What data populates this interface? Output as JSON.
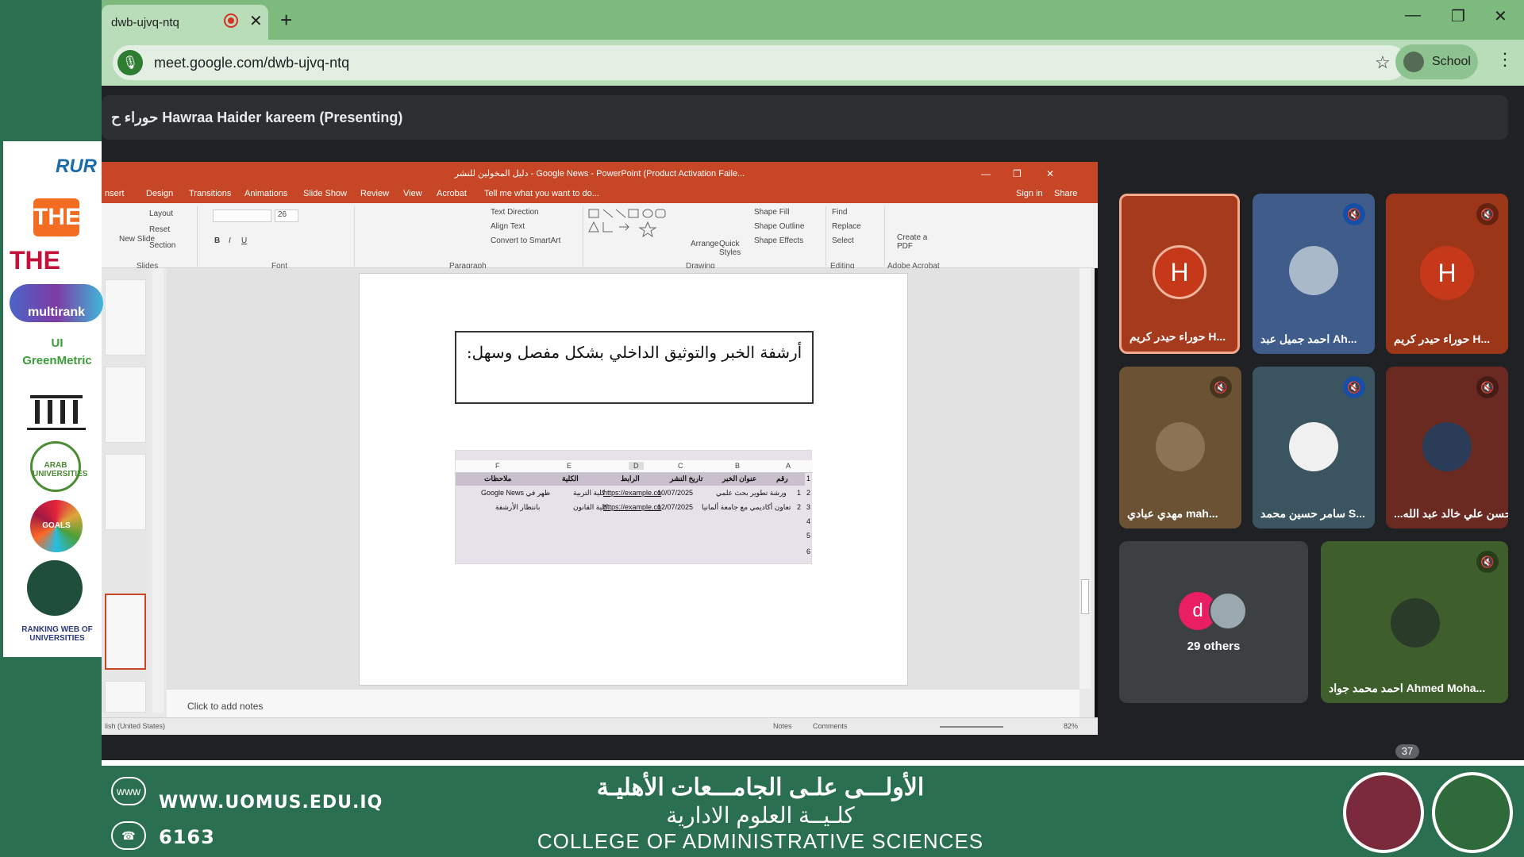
{
  "browser": {
    "tab_title": "dwb-ujvq-ntq",
    "url": "meet.google.com/dwb-ujvq-ntq",
    "profile_label": "School"
  },
  "meet": {
    "presenting_banner": "حوراء ح Hawraa Haider kareem (Presenting)",
    "participant_count": "37",
    "tiles": [
      {
        "name": "حوراء حيدر كريم H...",
        "avatar_letter": "H",
        "muted": false
      },
      {
        "name": "احمد جميل عبد Ah...",
        "avatar_letter": "",
        "muted": true
      },
      {
        "name": "حوراء حيدر كريم H...",
        "avatar_letter": "H",
        "muted": true
      },
      {
        "name": "مهدي عبادي mah...",
        "avatar_letter": "",
        "muted": true
      },
      {
        "name": "سامر حسين محمد S...",
        "avatar_letter": "",
        "muted": true
      },
      {
        "name": "...حسن علي خالد عبد الله",
        "avatar_letter": "",
        "muted": true
      },
      {
        "name": "29 others",
        "avatar_letter": "d",
        "muted": false
      },
      {
        "name": "احمد محمد جواد Ahmed Moha...",
        "avatar_letter": "",
        "muted": true
      }
    ]
  },
  "ppt": {
    "title": "دليل المخولين للنشر - Google News - PowerPoint (Product Activation Faile...",
    "menu": [
      "nsert",
      "Design",
      "Transitions",
      "Animations",
      "Slide Show",
      "Review",
      "View",
      "Acrobat"
    ],
    "tell_me": "Tell me what you want to do...",
    "sign_in": "Sign in",
    "share": "Share",
    "ribbon": {
      "layout": "Layout",
      "reset": "Reset",
      "section": "Section",
      "new_slide": "New Slide",
      "font_size": "26",
      "text_direction": "Text Direction",
      "align_text": "Align Text",
      "convert_smartart": "Convert to SmartArt",
      "arrange": "Arrange",
      "quick_styles": "Quick Styles",
      "shape_fill": "Shape Fill",
      "shape_outline": "Shape Outline",
      "shape_effects": "Shape Effects",
      "find": "Find",
      "replace": "Replace",
      "select": "Select",
      "create_pdf": "Create a PDF",
      "groups": [
        "Slides",
        "Font",
        "Paragraph",
        "Drawing",
        "Editing",
        "Adobe Acrobat"
      ]
    },
    "slide": {
      "heading": "أرشفة الخبر والتوثيق الداخلي بشكل مفصل وسهل:",
      "sheet_cols": [
        "F",
        "E",
        "D",
        "C",
        "B",
        "A"
      ],
      "sheet_headers": [
        "ملاحظات",
        "الكلية",
        "الرابط",
        "تاريخ النشر",
        "عنوان الخبر",
        "رقم"
      ],
      "rows": [
        [
          "ظهر في Google News",
          "كلية التربية",
          "https://example.co",
          "10/07/2025",
          "ورشة تطوير بحث علمي",
          "1"
        ],
        [
          "بانتظار الأرشفة",
          "كلية القانون",
          "https://example.co",
          "12/07/2025",
          "تعاون أكاديمي مع جامعة ألمانيا",
          "2"
        ]
      ],
      "row_numbers": [
        "1",
        "2",
        "3",
        "4",
        "5",
        "6"
      ]
    },
    "notes_placeholder": "Click to add notes",
    "status": {
      "language": "lish (United States)",
      "notes": "Notes",
      "comments": "Comments",
      "zoom": "82%"
    }
  },
  "footer": {
    "website": "WWW.UOMUS.EDU.IQ",
    "phone": "6163",
    "arabic_university": "الأولـــى علـى الجامـــعات الأهليـة",
    "arabic_college": "كلـيــة العلوم الادارية",
    "english_college": "COLLEGE OF ADMINISTRATIVE SCIENCES"
  },
  "logos": [
    "RUR",
    "THE",
    "THE",
    "multirank",
    "UI GreenMetric",
    "ARAB UNIVERSITIES",
    "GOALS",
    "RANKING WEB OF UNIVERSITIES"
  ]
}
